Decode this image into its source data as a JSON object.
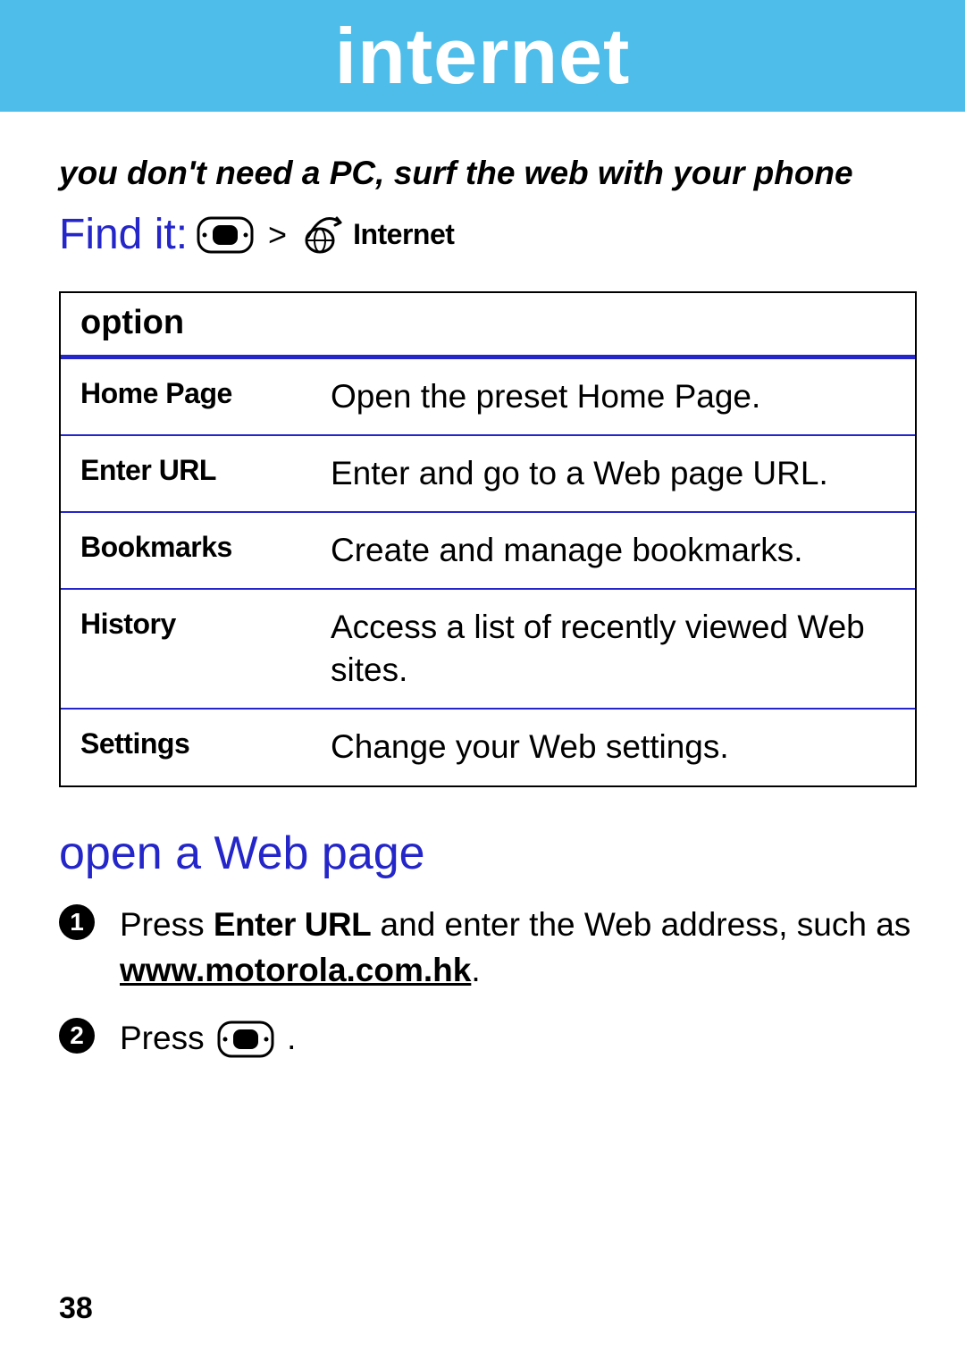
{
  "banner": {
    "title": "internet"
  },
  "tagline": "you don't need a PC, surf the web with your phone",
  "findit": {
    "label": "Find it:",
    "app": "Internet",
    "caret": ">"
  },
  "icons": {
    "nav_key": "nav-key-icon",
    "globe": "globe-icon"
  },
  "options_table": {
    "header": "option",
    "rows": [
      {
        "name": "Home Page",
        "desc": "Open the preset Home Page."
      },
      {
        "name": "Enter URL",
        "desc": "Enter and go to a Web page URL."
      },
      {
        "name": "Bookmarks",
        "desc": "Create and manage bookmarks."
      },
      {
        "name": "History",
        "desc": "Access a list of recently viewed Web sites."
      },
      {
        "name": "Settings",
        "desc": "Change your Web settings."
      }
    ]
  },
  "section": {
    "heading": "open a Web page"
  },
  "steps": {
    "s1": {
      "num": "1",
      "pre": "Press ",
      "bold1": "Enter URL",
      "mid": " and enter the Web address, such as ",
      "url": "www.motorola.com.hk",
      "post": "."
    },
    "s2": {
      "num": "2",
      "pre": "Press ",
      "post": " ."
    }
  },
  "page_number": "38"
}
